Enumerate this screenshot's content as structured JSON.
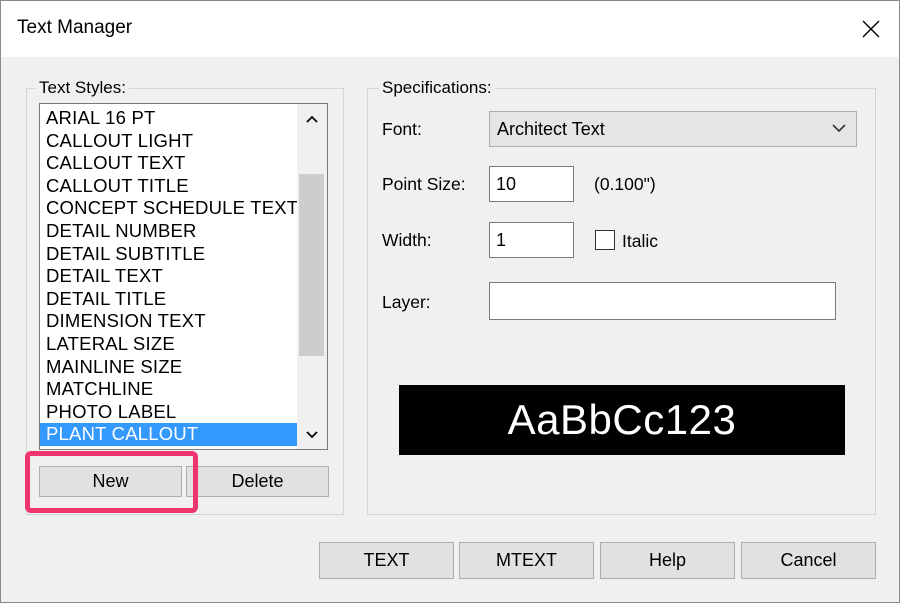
{
  "window": {
    "title": "Text Manager",
    "close_icon": "close-icon"
  },
  "text_styles": {
    "group_label": "Text Styles:",
    "items": [
      {
        "label": "ARIAL 16 PT",
        "selected": false
      },
      {
        "label": "CALLOUT LIGHT",
        "selected": false
      },
      {
        "label": "CALLOUT TEXT",
        "selected": false
      },
      {
        "label": "CALLOUT TITLE",
        "selected": false
      },
      {
        "label": "CONCEPT SCHEDULE TEXT",
        "selected": false
      },
      {
        "label": "DETAIL NUMBER",
        "selected": false
      },
      {
        "label": "DETAIL SUBTITLE",
        "selected": false
      },
      {
        "label": "DETAIL TEXT",
        "selected": false
      },
      {
        "label": "DETAIL TITLE",
        "selected": false
      },
      {
        "label": "DIMENSION TEXT",
        "selected": false
      },
      {
        "label": "LATERAL SIZE",
        "selected": false
      },
      {
        "label": "MAINLINE SIZE",
        "selected": false
      },
      {
        "label": "MATCHLINE",
        "selected": false
      },
      {
        "label": "PHOTO LABEL",
        "selected": false
      },
      {
        "label": "PLANT CALLOUT",
        "selected": true
      }
    ],
    "new_label": "New",
    "delete_label": "Delete",
    "scroll_up_icon": "chevron-up-icon",
    "scroll_down_icon": "chevron-down-icon"
  },
  "specifications": {
    "group_label": "Specifications:",
    "font_label": "Font:",
    "font_value": "Architect Text",
    "point_size_label": "Point Size:",
    "point_size_value": "10",
    "point_size_inches": "(0.100\")",
    "width_label": "Width:",
    "width_value": "1",
    "italic_label": "Italic",
    "italic_checked": false,
    "layer_label": "Layer:",
    "layer_value": "",
    "preview_text": "AaBbCc123"
  },
  "footer": {
    "text_label": "TEXT",
    "mtext_label": "MTEXT",
    "help_label": "Help",
    "cancel_label": "Cancel"
  },
  "colors": {
    "selection": "#3399ff",
    "highlight": "#f0346e",
    "preview_bg": "#000000"
  }
}
